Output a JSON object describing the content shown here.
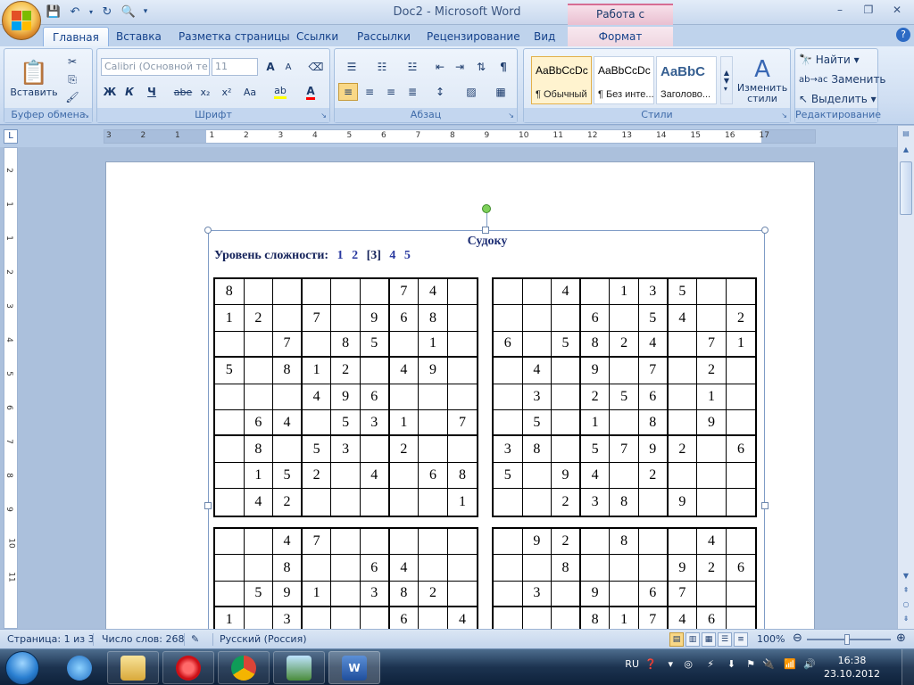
{
  "window": {
    "title": "Doc2 - Microsoft Word",
    "context_group": "Работа с рисунками",
    "minimize": "–",
    "restore": "❐",
    "close": "✕"
  },
  "tabs": [
    "Главная",
    "Вставка",
    "Разметка страницы",
    "Ссылки",
    "Рассылки",
    "Рецензирование",
    "Вид",
    "Формат"
  ],
  "ribbon": {
    "clipboard": {
      "label": "Буфер обмена",
      "paste": "Вставить"
    },
    "font": {
      "label": "Шрифт",
      "font_name": "Calibri (Основной те",
      "font_size": "11",
      "grow": "A",
      "shrink": "A",
      "bold": "Ж",
      "italic": "К",
      "underline": "Ч",
      "strike": "abe",
      "sub": "x₂",
      "sup": "x²",
      "case": "Aa"
    },
    "paragraph": {
      "label": "Абзац"
    },
    "styles": {
      "label": "Стили",
      "items": [
        {
          "sample": "AaBbCcDc",
          "name": "¶ Обычный"
        },
        {
          "sample": "AaBbCcDc",
          "name": "¶ Без инте..."
        },
        {
          "sample": "AaBbC",
          "name": "Заголово..."
        }
      ],
      "change_styles": "Изменить стили"
    },
    "editing": {
      "label": "Редактирование",
      "find": "Найти",
      "replace": "Заменить",
      "select": "Выделить"
    }
  },
  "ruler": {
    "h_numbers": [
      "3",
      "2",
      "1",
      "1",
      "2",
      "3",
      "4",
      "5",
      "6",
      "7",
      "8",
      "9",
      "10",
      "11",
      "12",
      "13",
      "14",
      "15",
      "16",
      "17"
    ],
    "v_numbers": [
      "2",
      "1",
      "1",
      "2",
      "3",
      "4",
      "5",
      "6",
      "7",
      "8",
      "9",
      "10",
      "11"
    ]
  },
  "document": {
    "title": "Судоку",
    "level_label": "Уровень сложности:",
    "levels": [
      "1",
      "2",
      "[3]",
      "4",
      "5"
    ],
    "grid1": [
      [
        "8",
        "",
        "",
        "",
        "",
        "",
        "7",
        "4",
        ""
      ],
      [
        "1",
        "2",
        "",
        "7",
        "",
        "9",
        "6",
        "8",
        ""
      ],
      [
        "",
        "",
        "7",
        "",
        "8",
        "5",
        "",
        "1",
        ""
      ],
      [
        "5",
        "",
        "8",
        "1",
        "2",
        "",
        "4",
        "9",
        ""
      ],
      [
        "",
        "",
        "",
        "4",
        "9",
        "6",
        "",
        "",
        ""
      ],
      [
        "",
        "6",
        "4",
        "",
        "5",
        "3",
        "1",
        "",
        "7"
      ],
      [
        "",
        "8",
        "",
        "5",
        "3",
        "",
        "2",
        "",
        ""
      ],
      [
        "",
        "1",
        "5",
        "2",
        "",
        "4",
        "",
        "6",
        "8"
      ],
      [
        "",
        "4",
        "2",
        "",
        "",
        "",
        "",
        "",
        "1"
      ]
    ],
    "grid2": [
      [
        "",
        "",
        "4",
        "",
        "1",
        "3",
        "5",
        "",
        ""
      ],
      [
        "",
        "",
        "",
        "6",
        "",
        "5",
        "4",
        "",
        "2"
      ],
      [
        "6",
        "",
        "5",
        "8",
        "2",
        "4",
        "",
        "7",
        "1"
      ],
      [
        "",
        "4",
        "",
        "9",
        "",
        "7",
        "",
        "2",
        ""
      ],
      [
        "",
        "3",
        "",
        "2",
        "5",
        "6",
        "",
        "1",
        ""
      ],
      [
        "",
        "5",
        "",
        "1",
        "",
        "8",
        "",
        "9",
        ""
      ],
      [
        "3",
        "8",
        "",
        "5",
        "7",
        "9",
        "2",
        "",
        "6"
      ],
      [
        "5",
        "",
        "9",
        "4",
        "",
        "2",
        "",
        "",
        ""
      ],
      [
        "",
        "",
        "2",
        "3",
        "8",
        "",
        "9",
        "",
        ""
      ]
    ],
    "grid3": [
      [
        "",
        "",
        "4",
        "7",
        "",
        "",
        "",
        "",
        ""
      ],
      [
        "",
        "",
        "8",
        "",
        "",
        "6",
        "4",
        "",
        ""
      ],
      [
        "",
        "5",
        "9",
        "1",
        "",
        "3",
        "8",
        "2",
        ""
      ],
      [
        "1",
        "",
        "3",
        "",
        "",
        "",
        "6",
        "",
        "4"
      ]
    ],
    "grid4": [
      [
        "",
        "9",
        "2",
        "",
        "8",
        "",
        "",
        "4",
        ""
      ],
      [
        "",
        "",
        "8",
        "",
        "",
        "",
        "9",
        "2",
        "6"
      ],
      [
        "",
        "3",
        "",
        "9",
        "",
        "6",
        "7",
        "",
        ""
      ],
      [
        "",
        "",
        "",
        "8",
        "1",
        "7",
        "4",
        "6",
        ""
      ]
    ]
  },
  "status": {
    "page": "Страница: 1 из 3",
    "words": "Число слов: 268",
    "language": "Русский (Россия)",
    "zoom": "100%"
  },
  "taskbar": {
    "lang": "RU",
    "time": "16:38",
    "date": "23.10.2012"
  }
}
